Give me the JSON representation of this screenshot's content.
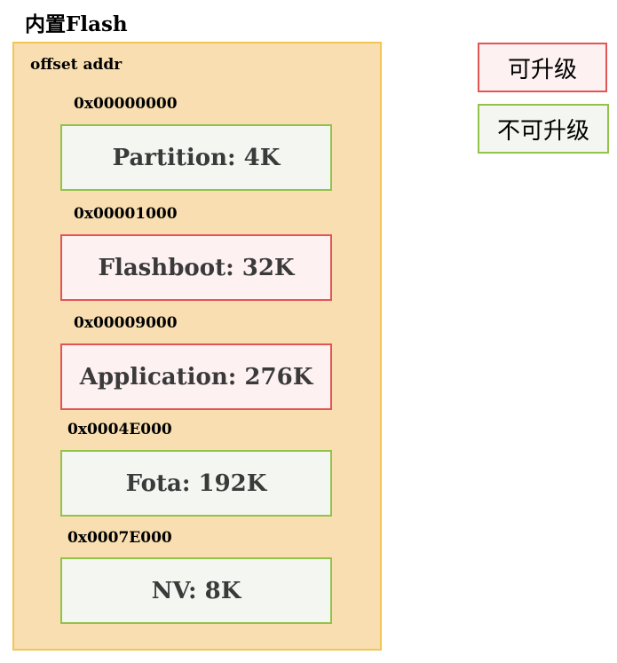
{
  "title": "内置Flash",
  "offset_label": "offset addr",
  "regions": [
    {
      "address": "0x00000000",
      "label": "Partition: 4K",
      "upgradable": false
    },
    {
      "address": "0x00001000",
      "label": "Flashboot: 32K",
      "upgradable": true
    },
    {
      "address": "0x00009000",
      "label": "Application: 276K",
      "upgradable": true
    },
    {
      "address": "0x0004E000",
      "label": "Fota: 192K",
      "upgradable": false
    },
    {
      "address": "0x0007E000",
      "label": "NV: 8K",
      "upgradable": false
    }
  ],
  "legend": {
    "upgradable": "可升级",
    "not_upgradable": "不可升级"
  },
  "colors": {
    "flash_fill": "#f8deb0",
    "flash_border": "#f3c555",
    "upgradable_border": "#e25555",
    "upgradable_fill": "#fdf1f1",
    "not_upgradable_border": "#92c24a",
    "not_upgradable_fill": "#f4f7f1"
  }
}
